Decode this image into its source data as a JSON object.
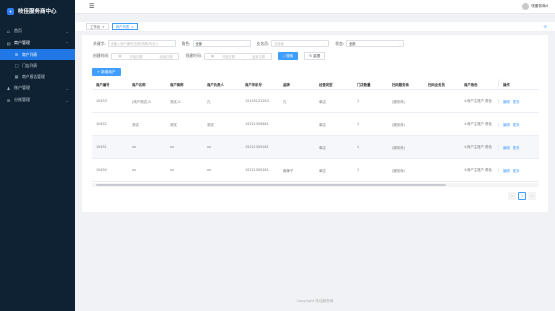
{
  "sidebar": {
    "brand_icon": "logo-icon",
    "brand_title": "吱佳服务商中心",
    "items": [
      {
        "label": "首页",
        "icon": "home-icon"
      },
      {
        "label": "商户管理",
        "icon": "shop-icon"
      },
      {
        "label": "商户列表",
        "icon": "list-icon"
      },
      {
        "label": "门店列表",
        "icon": "store-icon"
      },
      {
        "label": "商户报告管理",
        "icon": "report-icon"
      },
      {
        "label": "账户管理",
        "icon": "user-icon"
      },
      {
        "label": "分账管理",
        "icon": "split-icon"
      }
    ]
  },
  "topbar": {
    "menu_icon": "hamburger-icon",
    "user_label": "吱服务商4"
  },
  "tags": [
    {
      "label": "工作台"
    },
    {
      "label": "商户列表"
    }
  ],
  "filters": {
    "keyword_label": "关键字:",
    "keyword_placeholder": "请输入商户编号/名称/简称/负责人",
    "role_label": "角色:",
    "role_value": "全部",
    "level_label": "业务员:",
    "level_placeholder": "请选择",
    "status_label": "状态:",
    "status_value": "全部",
    "create_label": "创建时间:",
    "bind_label": "领建时间:",
    "date_start": "开始日期",
    "date_sep": "-",
    "date_end": "结束日期",
    "search_btn": "搜索",
    "reset_btn": "重置"
  },
  "add_button": "+ 新增商户",
  "table": {
    "headers": [
      "商户编号",
      "商户名称",
      "商户简称",
      "商户负责人",
      "商户手机号",
      "品牌",
      "经营类型",
      "门店数量",
      "扫码服务商",
      "扫码业务员",
      "商户角色",
      "操作"
    ],
    "rows": [
      [
        "10453",
        "(商户测试-G",
        "测试-G",
        "孔",
        "15155121283",
        "孔",
        "单店",
        "1",
        "(服务商)",
        "",
        "①商户主账户 角色",
        ""
      ],
      [
        "10452",
        "测试",
        "测试",
        "测试",
        "15221309481",
        "",
        "单店",
        "1",
        "(服务商)",
        "",
        "①商户主账户 角色",
        ""
      ],
      [
        "10451",
        "xx",
        "xx",
        "xx",
        "15221309181",
        "",
        "单店",
        "1",
        "(服务商)",
        "",
        "①商户主账户 角色",
        ""
      ],
      [
        "10450",
        "xx",
        "xx",
        "xx",
        "15221309181",
        "麻辣子",
        "单店",
        "1",
        "(服务商)",
        "",
        "①商户主账户 角色",
        ""
      ]
    ],
    "op_edit": "编辑",
    "op_more": "更多"
  },
  "pagination": {
    "prev": "‹",
    "current": "1",
    "next": "›"
  },
  "footer": "Copyright 吱佳服务商"
}
